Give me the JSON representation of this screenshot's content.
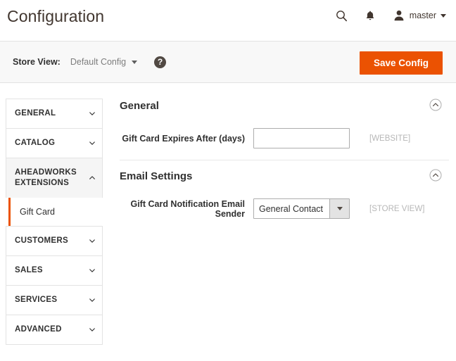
{
  "header": {
    "title": "Configuration",
    "search_icon": "search-icon",
    "notifications_icon": "bell-icon",
    "avatar_icon": "user-avatar-icon",
    "user_name": "master",
    "user_caret_icon": "chevron-down-icon"
  },
  "storeview": {
    "label": "Store View:",
    "selected": "Default Config",
    "caret_icon": "chevron-down-icon",
    "help_icon": "question-mark-icon",
    "help_glyph": "?",
    "save_label": "Save Config"
  },
  "sidebar": {
    "sections": [
      {
        "label": "GENERAL",
        "chevron": "chevron-down-icon",
        "expanded": false
      },
      {
        "label": "CATALOG",
        "chevron": "chevron-down-icon",
        "expanded": false
      },
      {
        "label": "AHEADWORKS EXTENSIONS",
        "chevron": "chevron-up-icon",
        "expanded": true
      },
      {
        "label": "CUSTOMERS",
        "chevron": "chevron-down-icon",
        "expanded": false
      },
      {
        "label": "SALES",
        "chevron": "chevron-down-icon",
        "expanded": false
      },
      {
        "label": "SERVICES",
        "chevron": "chevron-down-icon",
        "expanded": false
      },
      {
        "label": "ADVANCED",
        "chevron": "chevron-down-icon",
        "expanded": false
      }
    ],
    "subitems": [
      {
        "label": "Gift Card",
        "current": true
      }
    ]
  },
  "main": {
    "sections": [
      {
        "title": "General",
        "toggle_icon": "collapse-circle-up-icon",
        "field_label": "Gift Card Expires After (days)",
        "field_value": "",
        "field_placeholder": "",
        "scope": "[WEBSITE]"
      },
      {
        "title": "Email Settings",
        "toggle_icon": "collapse-circle-up-icon",
        "field_label": "Gift Card Notification Email Sender",
        "field_value": "General Contact",
        "scope": "[STORE VIEW]"
      }
    ]
  },
  "colors": {
    "accent": "#eb5202",
    "header_text": "#41362f",
    "scope_text": "#b7b7b7",
    "border": "#e3e3e3"
  }
}
